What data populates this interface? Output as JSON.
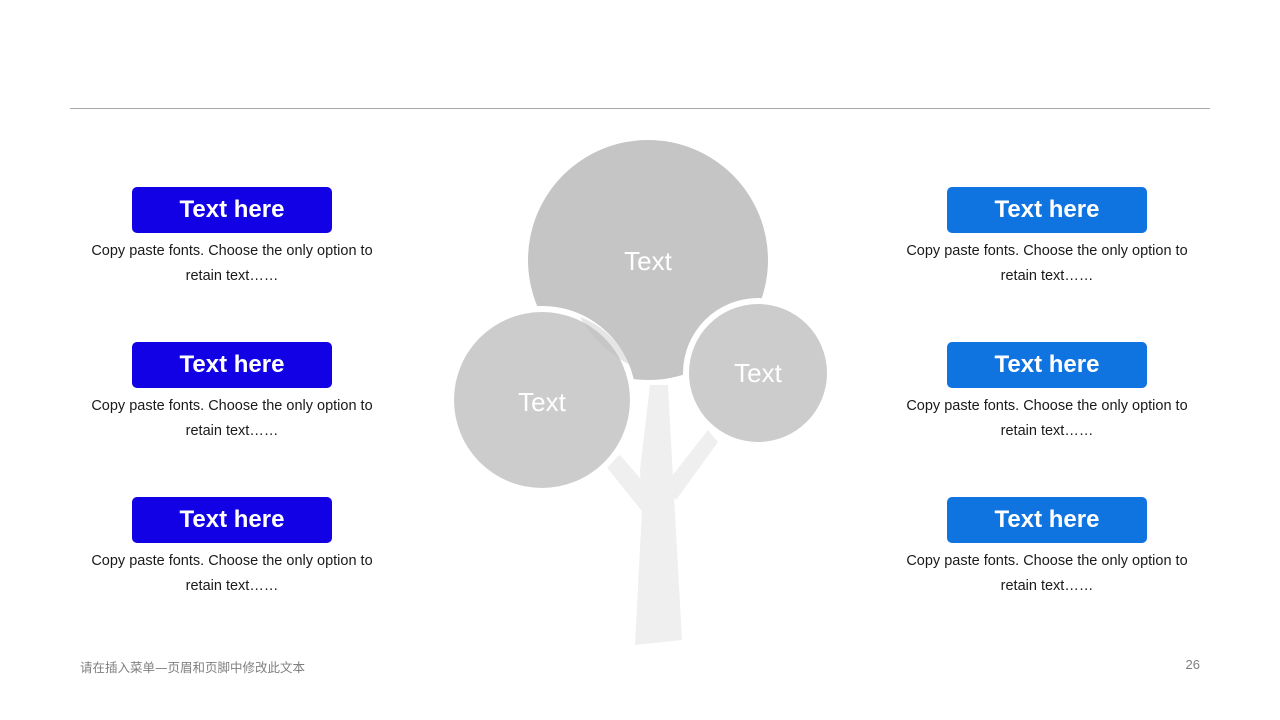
{
  "left_items": [
    {
      "title": "Text here",
      "desc_line1": "Copy paste fonts. Choose the only option to",
      "desc_line2": "retain text……"
    },
    {
      "title": "Text here",
      "desc_line1": "Copy paste fonts. Choose the only option to",
      "desc_line2": "retain text……"
    },
    {
      "title": "Text here",
      "desc_line1": "Copy paste fonts. Choose the only option to",
      "desc_line2": "retain text……"
    }
  ],
  "right_items": [
    {
      "title": "Text here",
      "desc_line1": "Copy paste fonts. Choose the only option to",
      "desc_line2": "retain text……"
    },
    {
      "title": "Text here",
      "desc_line1": "Copy paste fonts. Choose the only option to",
      "desc_line2": "retain text……"
    },
    {
      "title": "Text here",
      "desc_line1": "Copy paste fonts. Choose the only option to",
      "desc_line2": "retain text……"
    }
  ],
  "tree": {
    "top_bubble": "Text",
    "left_bubble": "Text",
    "right_bubble": "Text"
  },
  "footer": {
    "text": "请在插入菜单—页眉和页脚中修改此文本",
    "page_number": "26"
  },
  "colors": {
    "left_badge": "#1201e5",
    "right_badge": "#0f73e0",
    "bubble": "#bfbfbf",
    "trunk": "#efefef",
    "rule": "#a6a6a6"
  }
}
